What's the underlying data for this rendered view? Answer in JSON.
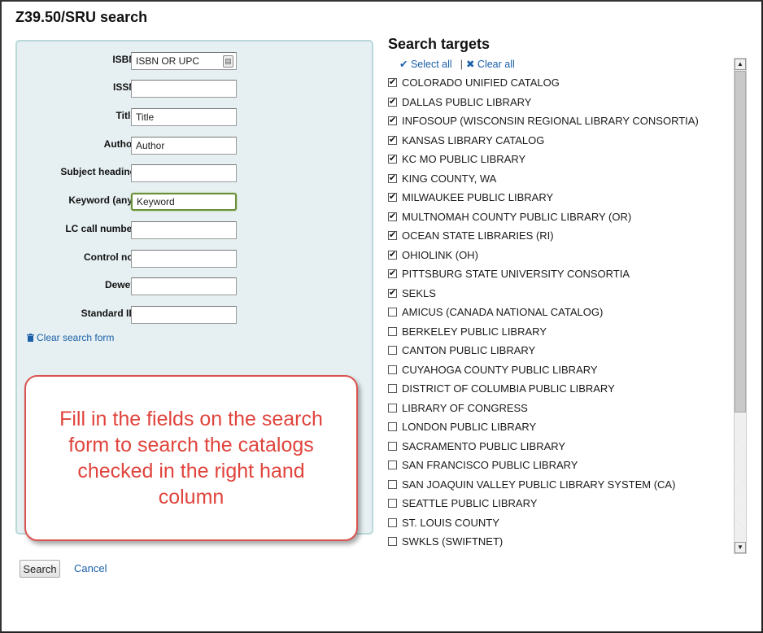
{
  "dialog": {
    "title": "Z39.50/SRU search"
  },
  "form": {
    "fields": [
      {
        "label": "ISBN:",
        "value": "ISBN OR UPC"
      },
      {
        "label": "ISSN:",
        "value": ""
      },
      {
        "label": "Title:",
        "value": "Title"
      },
      {
        "label": "Author:",
        "value": "Author"
      },
      {
        "label": "Subject heading:",
        "value": ""
      },
      {
        "label": "Keyword (any):",
        "value": "Keyword"
      },
      {
        "label": "LC call number:",
        "value": ""
      },
      {
        "label": "Control no.:",
        "value": ""
      },
      {
        "label": "Dewey:",
        "value": ""
      },
      {
        "label": "Standard ID:",
        "value": ""
      }
    ],
    "clear_label": "Clear search form"
  },
  "callout": {
    "text": "Fill in the fields on the search form to search the catalogs checked in the right hand column"
  },
  "buttons": {
    "search": "Search",
    "cancel": "Cancel"
  },
  "targets": {
    "heading": "Search targets",
    "select_all": "Select all",
    "clear_all": "Clear all",
    "items": [
      {
        "name": "COLORADO UNIFIED CATALOG",
        "checked": true
      },
      {
        "name": "DALLAS PUBLIC LIBRARY",
        "checked": true
      },
      {
        "name": "INFOSOUP (WISCONSIN REGIONAL LIBRARY CONSORTIA)",
        "checked": true
      },
      {
        "name": "KANSAS LIBRARY CATALOG",
        "checked": true
      },
      {
        "name": "KC MO PUBLIC LIBRARY",
        "checked": true
      },
      {
        "name": "KING COUNTY, WA",
        "checked": true
      },
      {
        "name": "MILWAUKEE PUBLIC LIBRARY",
        "checked": true
      },
      {
        "name": "MULTNOMAH COUNTY PUBLIC LIBRARY (OR)",
        "checked": true
      },
      {
        "name": "OCEAN STATE LIBRARIES (RI)",
        "checked": true
      },
      {
        "name": "OHIOLINK (OH)",
        "checked": true
      },
      {
        "name": "PITTSBURG STATE UNIVERSITY CONSORTIA",
        "checked": true
      },
      {
        "name": "SEKLS",
        "checked": true
      },
      {
        "name": "AMICUS (CANADA NATIONAL CATALOG)",
        "checked": false
      },
      {
        "name": "BERKELEY PUBLIC LIBRARY",
        "checked": false
      },
      {
        "name": "CANTON PUBLIC LIBRARY",
        "checked": false
      },
      {
        "name": "CUYAHOGA COUNTY PUBLIC LIBRARY",
        "checked": false
      },
      {
        "name": "DISTRICT OF COLUMBIA PUBLIC LIBRARY",
        "checked": false
      },
      {
        "name": "LIBRARY OF CONGRESS",
        "checked": false
      },
      {
        "name": "LONDON PUBLIC LIBRARY",
        "checked": false
      },
      {
        "name": "SACRAMENTO PUBLIC LIBRARY",
        "checked": false
      },
      {
        "name": "SAN FRANCISCO PUBLIC LIBRARY",
        "checked": false
      },
      {
        "name": "SAN JOAQUIN VALLEY PUBLIC LIBRARY SYSTEM (CA)",
        "checked": false
      },
      {
        "name": "SEATTLE PUBLIC LIBRARY",
        "checked": false
      },
      {
        "name": "ST. LOUIS COUNTY",
        "checked": false
      },
      {
        "name": "SWKLS (SWIFTNET)",
        "checked": false
      }
    ]
  }
}
